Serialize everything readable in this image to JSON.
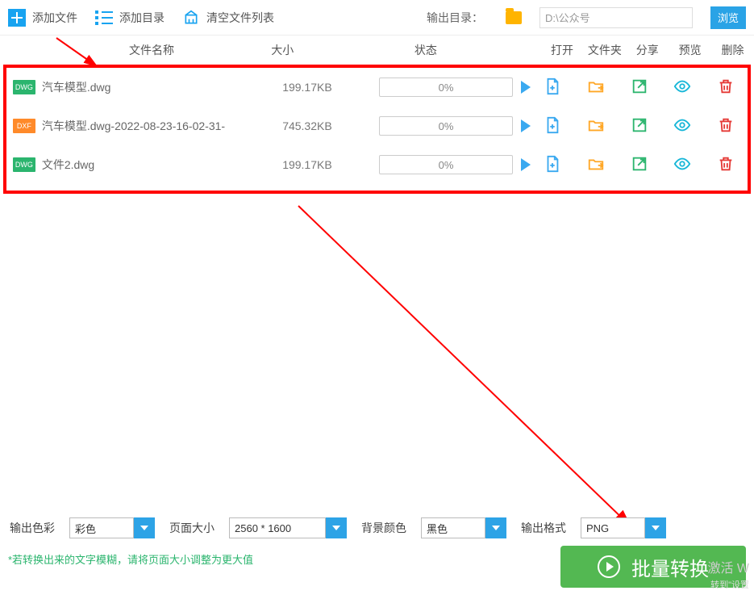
{
  "toolbar": {
    "add_file": "添加文件",
    "add_dir": "添加目录",
    "clear_list": "清空文件列表",
    "out_dir_label": "输出目录：",
    "out_dir_value": "D:\\公众号",
    "browse": "浏览"
  },
  "headers": {
    "name": "文件名称",
    "size": "大小",
    "status": "状态",
    "open": "打开",
    "folder": "文件夹",
    "share": "分享",
    "preview": "预览",
    "delete": "删除"
  },
  "files": [
    {
      "type": "DWG",
      "name": "汽车模型.dwg",
      "size": "199.17KB",
      "progress": "0%"
    },
    {
      "type": "DXF",
      "name": "汽车模型.dwg-2022-08-23-16-02-31-",
      "size": "745.32KB",
      "progress": "0%"
    },
    {
      "type": "DWG",
      "name": "文件2.dwg",
      "size": "199.17KB",
      "progress": "0%"
    }
  ],
  "settings": {
    "color_label": "输出色彩",
    "color_value": "彩色",
    "page_label": "页面大小",
    "page_value": "2560 * 1600",
    "bg_label": "背景颜色",
    "bg_value": "黑色",
    "format_label": "输出格式",
    "format_value": "PNG"
  },
  "hint": "*若转换出来的文字模糊，请将页面大小调整为更大值",
  "batch_button": "批量转换",
  "watermark1": "激活 W",
  "watermark2": "转到\"设置"
}
